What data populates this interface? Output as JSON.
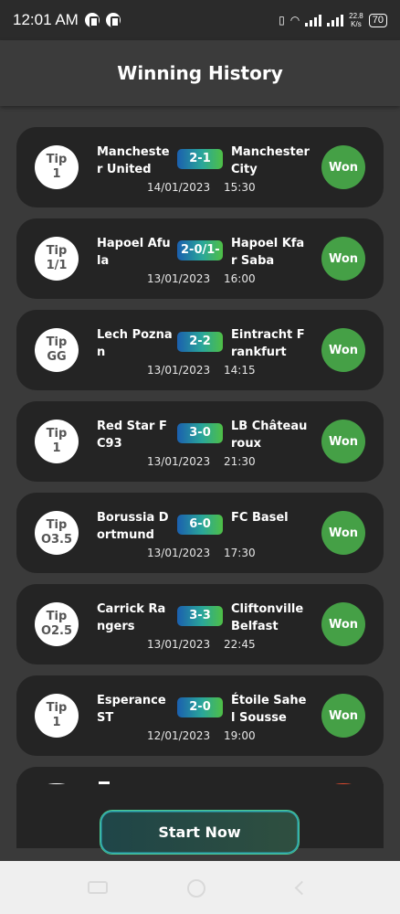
{
  "status_bar": {
    "time": "12:01 AM",
    "network_speed_value": "22.8",
    "network_speed_unit": "K/s",
    "battery": "70"
  },
  "header": {
    "title": "Winning History"
  },
  "matches": [
    {
      "tip_label": "Tip",
      "tip_value": "1",
      "home": "Manchester United",
      "away": "Manchester City",
      "score": "2-1",
      "date": "14/01/2023",
      "time": "15:30",
      "result": "Won"
    },
    {
      "tip_label": "Tip",
      "tip_value": "1/1",
      "home": "Hapoel Afula",
      "away": "Hapoel Kfar Saba",
      "score": "2-0/1-",
      "date": "13/01/2023",
      "time": "16:00",
      "result": "Won"
    },
    {
      "tip_label": "Tip",
      "tip_value": "GG",
      "home": "Lech Poznan",
      "away": "Eintracht Frankfurt",
      "score": "2-2",
      "date": "13/01/2023",
      "time": "14:15",
      "result": "Won"
    },
    {
      "tip_label": "Tip",
      "tip_value": "1",
      "home": "Red Star FC93",
      "away": "LB Château roux",
      "score": "3-0",
      "date": "13/01/2023",
      "time": "21:30",
      "result": "Won"
    },
    {
      "tip_label": "Tip",
      "tip_value": "O3.5",
      "home": "Borussia Dortmund",
      "away": "FC Basel",
      "score": "6-0",
      "date": "13/01/2023",
      "time": "17:30",
      "result": "Won"
    },
    {
      "tip_label": "Tip",
      "tip_value": "O2.5",
      "home": "Carrick Rangers",
      "away": "Cliftonville Belfast",
      "score": "3-3",
      "date": "13/01/2023",
      "time": "22:45",
      "result": "Won"
    },
    {
      "tip_label": "Tip",
      "tip_value": "1",
      "home": "Esperance ST",
      "away": "Étoile Sahel Sousse",
      "score": "2-0",
      "date": "12/01/2023",
      "time": "19:00",
      "result": "Won"
    }
  ],
  "start_button": {
    "label": "Start Now"
  },
  "colors": {
    "won": "#45a046",
    "card": "#242424",
    "background": "#3a3a3a",
    "score_gradient_start": "#1b5fae",
    "score_gradient_end": "#4fbf45"
  }
}
